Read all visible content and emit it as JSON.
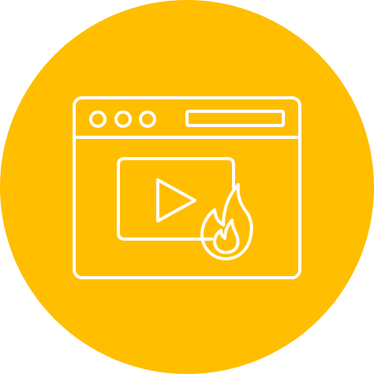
{
  "icon": {
    "semantic": "trending-video-icon",
    "parts": [
      "browser-window-icon",
      "play-button-icon",
      "fire-icon"
    ]
  },
  "colors": {
    "circle": "#FFBE00",
    "stroke": "#FFFFFF",
    "background": "#FFFFFF"
  }
}
